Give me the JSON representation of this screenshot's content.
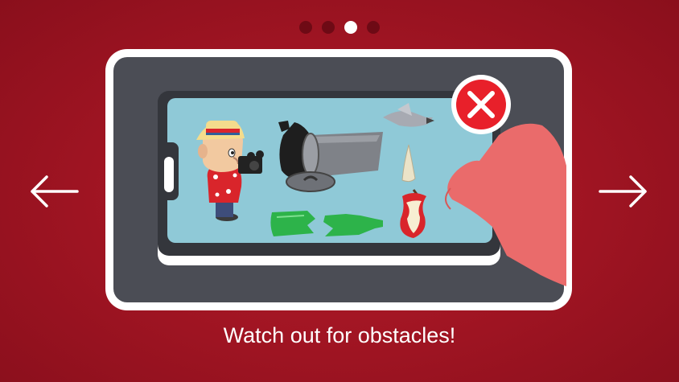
{
  "pagination": {
    "total": 4,
    "active_index": 2
  },
  "caption": "Watch out for obstacles!",
  "icons": {
    "prev": "arrow-left-icon",
    "next": "arrow-right-icon",
    "close": "close-x-icon"
  },
  "colors": {
    "background": "#9e1422",
    "tablet_bezel": "#4b4d55",
    "screen": "#8fc9d7",
    "close_badge": "#e8202a",
    "finger": "#ea6b6b"
  }
}
